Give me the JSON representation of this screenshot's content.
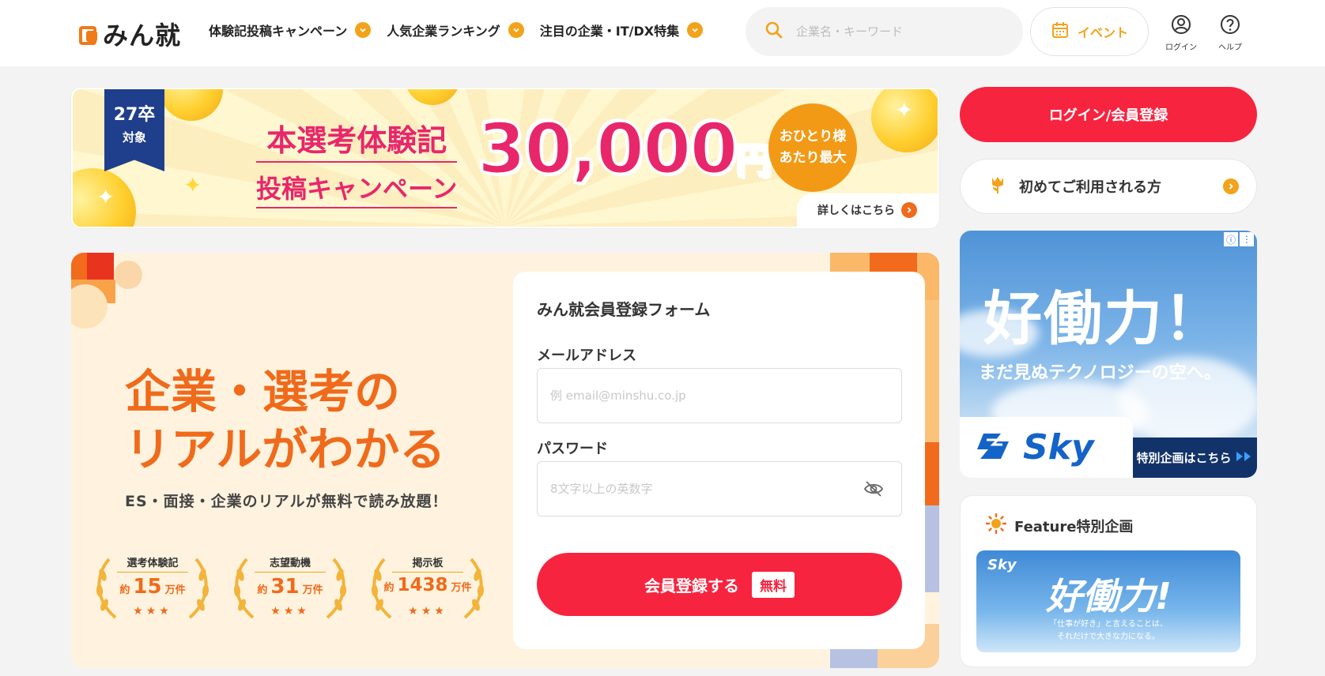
{
  "header": {
    "logo_text": "みん就",
    "nav": [
      "体験記投稿キャンペーン",
      "人気企業ランキング",
      "注目の企業・IT/DX特集"
    ],
    "search_placeholder": "企業名・キーワード",
    "event_label": "イベント",
    "login_label": "ログイン",
    "help_label": "ヘルプ"
  },
  "banner": {
    "badge_year": "27卒",
    "badge_target": "対象",
    "title_line1": "本選考体験記",
    "title_line2": "投稿キャンペーン",
    "amount": "30,000",
    "amount_unit": "円",
    "circle_line1": "おひとり様",
    "circle_line2": "あたり最大",
    "more_label": "詳しくはこちら"
  },
  "hero": {
    "title_line1": "企業・選考の",
    "title_line2": "リアルがわかる",
    "subtitle": "ES・面接・企業のリアルが無料で読み放題！",
    "stats": [
      {
        "label": "選考体験記",
        "prefix": "約",
        "value": "15",
        "unit": "万件",
        "stars": "★★★"
      },
      {
        "label": "志望動機",
        "prefix": "約",
        "value": "31",
        "unit": "万件",
        "stars": "★★★"
      },
      {
        "label": "掲示板",
        "prefix": "約",
        "value": "1438",
        "unit": "万件",
        "stars": "★★★"
      }
    ]
  },
  "form": {
    "title": "みん就会員登録フォーム",
    "email_label": "メールアドレス",
    "email_placeholder": "例 email@minshu.co.jp",
    "password_label": "パスワード",
    "password_placeholder": "8文字以上の英数字",
    "submit_label": "会員登録する",
    "free_tag": "無料"
  },
  "sidebar": {
    "login_register": "ログイン/会員登録",
    "first_time": "初めてご利用される方",
    "ad": {
      "title": "好働力！",
      "subtitle": "まだ見ぬテクノロジーの空へ。",
      "brand": "Sky",
      "cta": "特別企画はこちら"
    },
    "feature": {
      "heading": "Feature特別企画",
      "brand": "Sky",
      "title": "好働力!",
      "sub_line1": "「仕事が好き」と言えることは、",
      "sub_line2": "それだけで大きな力になる。"
    }
  },
  "colors": {
    "accent": "#f7243f",
    "orange": "#f06a1b",
    "yellow": "#f2a31b",
    "pink": "#e8276b",
    "navy": "#1f3e8c"
  }
}
